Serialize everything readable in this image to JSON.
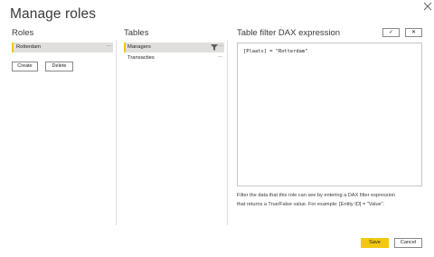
{
  "dialog": {
    "title": "Manage roles"
  },
  "roles": {
    "heading": "Roles",
    "items": [
      {
        "label": "Rotterdam",
        "more": "..."
      }
    ],
    "create_label": "Create",
    "delete_label": "Delete"
  },
  "tables": {
    "heading": "Tables",
    "items": [
      {
        "label": "Managers",
        "more": "...",
        "selected": true,
        "filtered": true
      },
      {
        "label": "Transacties",
        "more": "..."
      }
    ]
  },
  "dax": {
    "heading": "Table filter DAX expression",
    "confirm_symbol": "✓",
    "cancel_symbol": "✕",
    "expression": "[Plaats] = \"Rotterdam\"",
    "help_line1": "Filter the data that this role can see by entering a DAX filter expression",
    "help_line2": "that returns a True/False value. For example: [Entity ID] = \"Value\"."
  },
  "footer": {
    "save_label": "Save",
    "cancel_label": "Cancel"
  },
  "colors": {
    "accent": "#f2c811",
    "selected_bg": "#e1dfdd",
    "border": "#8a8886"
  }
}
